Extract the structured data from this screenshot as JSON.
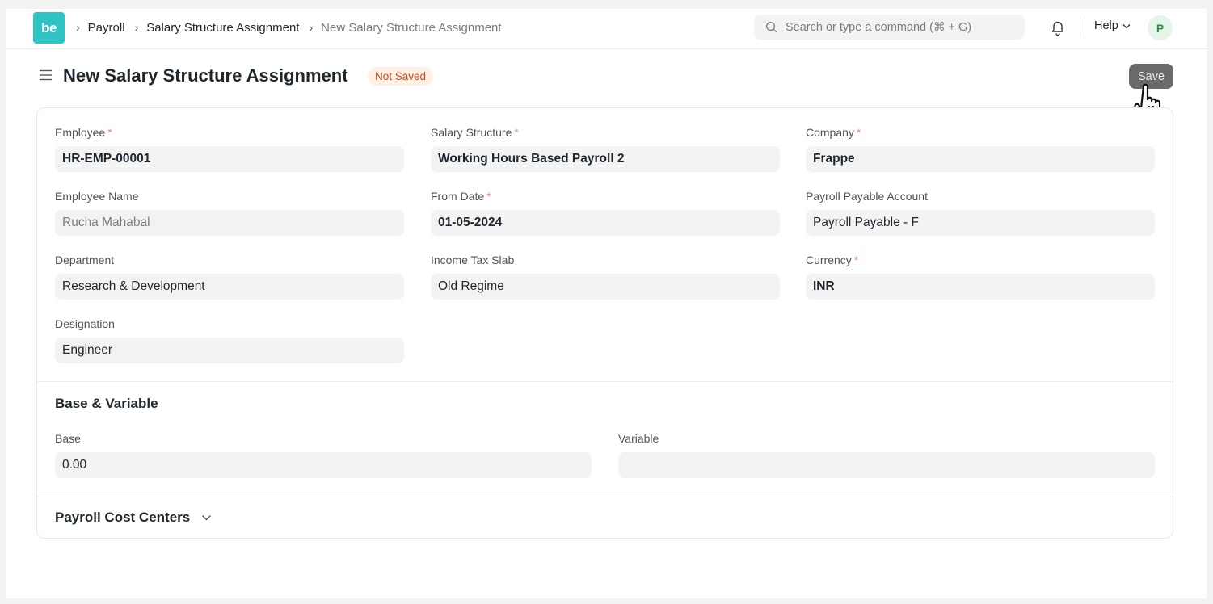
{
  "navbar": {
    "logo_text": "be",
    "breadcrumbs": [
      "Payroll",
      "Salary Structure Assignment"
    ],
    "current": "New Salary Structure Assignment",
    "search_placeholder": "Search or type a command (⌘ + G)",
    "help_label": "Help",
    "avatar_initial": "P"
  },
  "page": {
    "title": "New Salary Structure Assignment",
    "status": "Not Saved",
    "save_label": "Save"
  },
  "fields": {
    "employee": {
      "label": "Employee",
      "value": "HR-EMP-00001"
    },
    "salary_structure": {
      "label": "Salary Structure",
      "value": "Working Hours Based Payroll 2"
    },
    "company": {
      "label": "Company",
      "value": "Frappe"
    },
    "employee_name": {
      "label": "Employee Name",
      "value": "Rucha Mahabal"
    },
    "from_date": {
      "label": "From Date",
      "value": "01-05-2024"
    },
    "payroll_payable_account": {
      "label": "Payroll Payable Account",
      "value": "Payroll Payable - F"
    },
    "department": {
      "label": "Department",
      "value": "Research & Development"
    },
    "income_tax_slab": {
      "label": "Income Tax Slab",
      "value": "Old Regime"
    },
    "currency": {
      "label": "Currency",
      "value": "INR"
    },
    "designation": {
      "label": "Designation",
      "value": "Engineer"
    }
  },
  "base_variable": {
    "title": "Base & Variable",
    "base": {
      "label": "Base",
      "value": "0.00"
    },
    "variable": {
      "label": "Variable",
      "value": ""
    }
  },
  "cost_centers": {
    "title": "Payroll Cost Centers"
  },
  "colors": {
    "logo": "#2ec4c4",
    "status_bg": "#fff0e6",
    "status_text": "#c5501c",
    "save_button": "#6a6a6a"
  }
}
